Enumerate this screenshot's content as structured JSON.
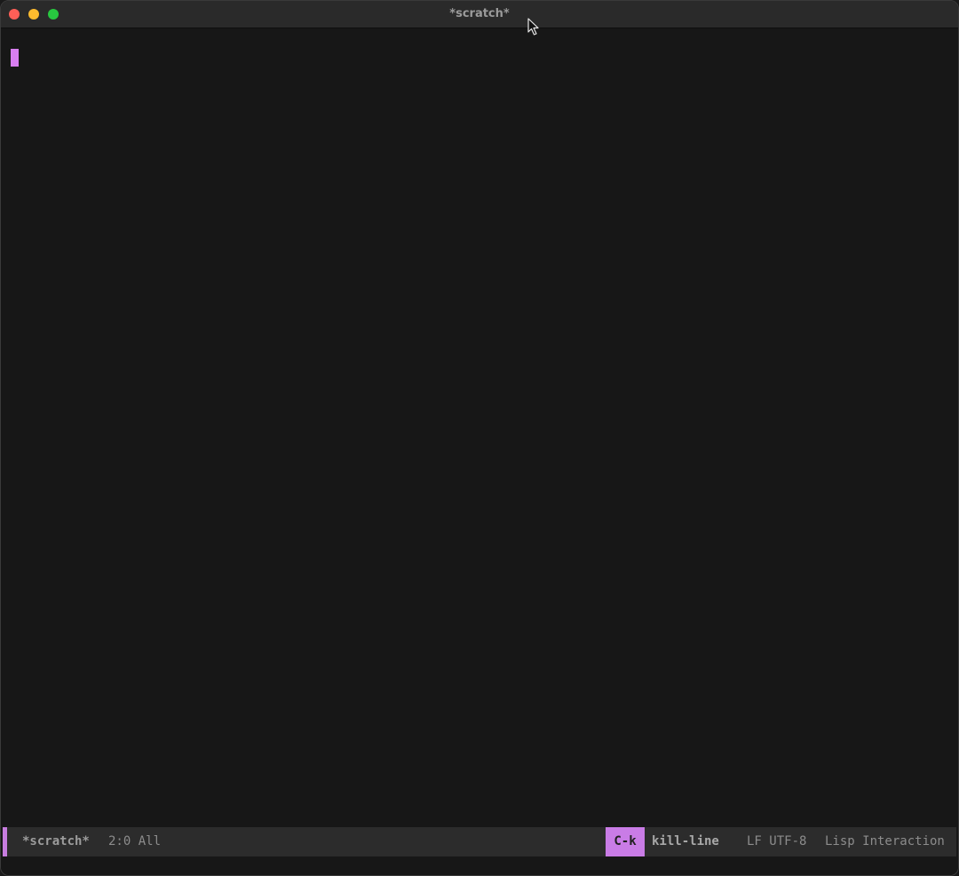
{
  "window": {
    "title": "*scratch*"
  },
  "icons": {
    "close": "close-icon",
    "minimize": "minimize-icon",
    "zoom": "zoom-icon",
    "pointer": "mouse-pointer-icon"
  },
  "colors": {
    "accent": "#c97ce6",
    "cursor": "#d87ef0",
    "background": "#171717",
    "modeline": "#2c2c2c"
  },
  "modeline": {
    "buffer_name": "*scratch*",
    "position": "2:0 All",
    "key": "C-k",
    "command": "kill-line",
    "encoding": "LF UTF-8",
    "major_mode": "Lisp Interaction"
  }
}
